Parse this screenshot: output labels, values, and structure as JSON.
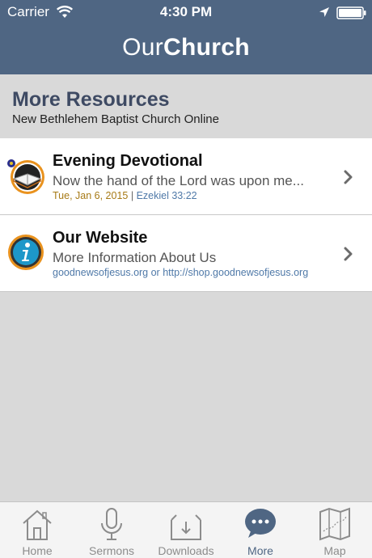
{
  "status_bar": {
    "carrier": "Carrier",
    "time": "4:30 PM"
  },
  "header": {
    "title_light": "Our",
    "title_bold": "Church"
  },
  "section": {
    "title": "More Resources",
    "subtitle": "New Bethlehem Baptist Church Online"
  },
  "items": [
    {
      "title": "Evening Devotional",
      "description": "Now the hand of the Lord was upon me...",
      "date": "Tue, Jan 6, 2015",
      "separator": "|",
      "reference": "Ezekiel 33:22",
      "icon": "book-icon"
    },
    {
      "title": "Our Website",
      "description": "More Information About Us",
      "link": "goodnewsofjesus.org or http://shop.goodnewsofjesus.org",
      "icon": "info-icon"
    }
  ],
  "tabs": [
    {
      "label": "Home",
      "icon": "home-icon"
    },
    {
      "label": "Sermons",
      "icon": "microphone-icon"
    },
    {
      "label": "Downloads",
      "icon": "download-icon"
    },
    {
      "label": "More",
      "icon": "more-icon",
      "active": true
    },
    {
      "label": "Map",
      "icon": "map-icon"
    }
  ],
  "colors": {
    "header": "#4f6683",
    "background": "#d9d9d9",
    "date": "#a77a16",
    "link": "#4f79a8",
    "active_tab": "#4f6683"
  }
}
